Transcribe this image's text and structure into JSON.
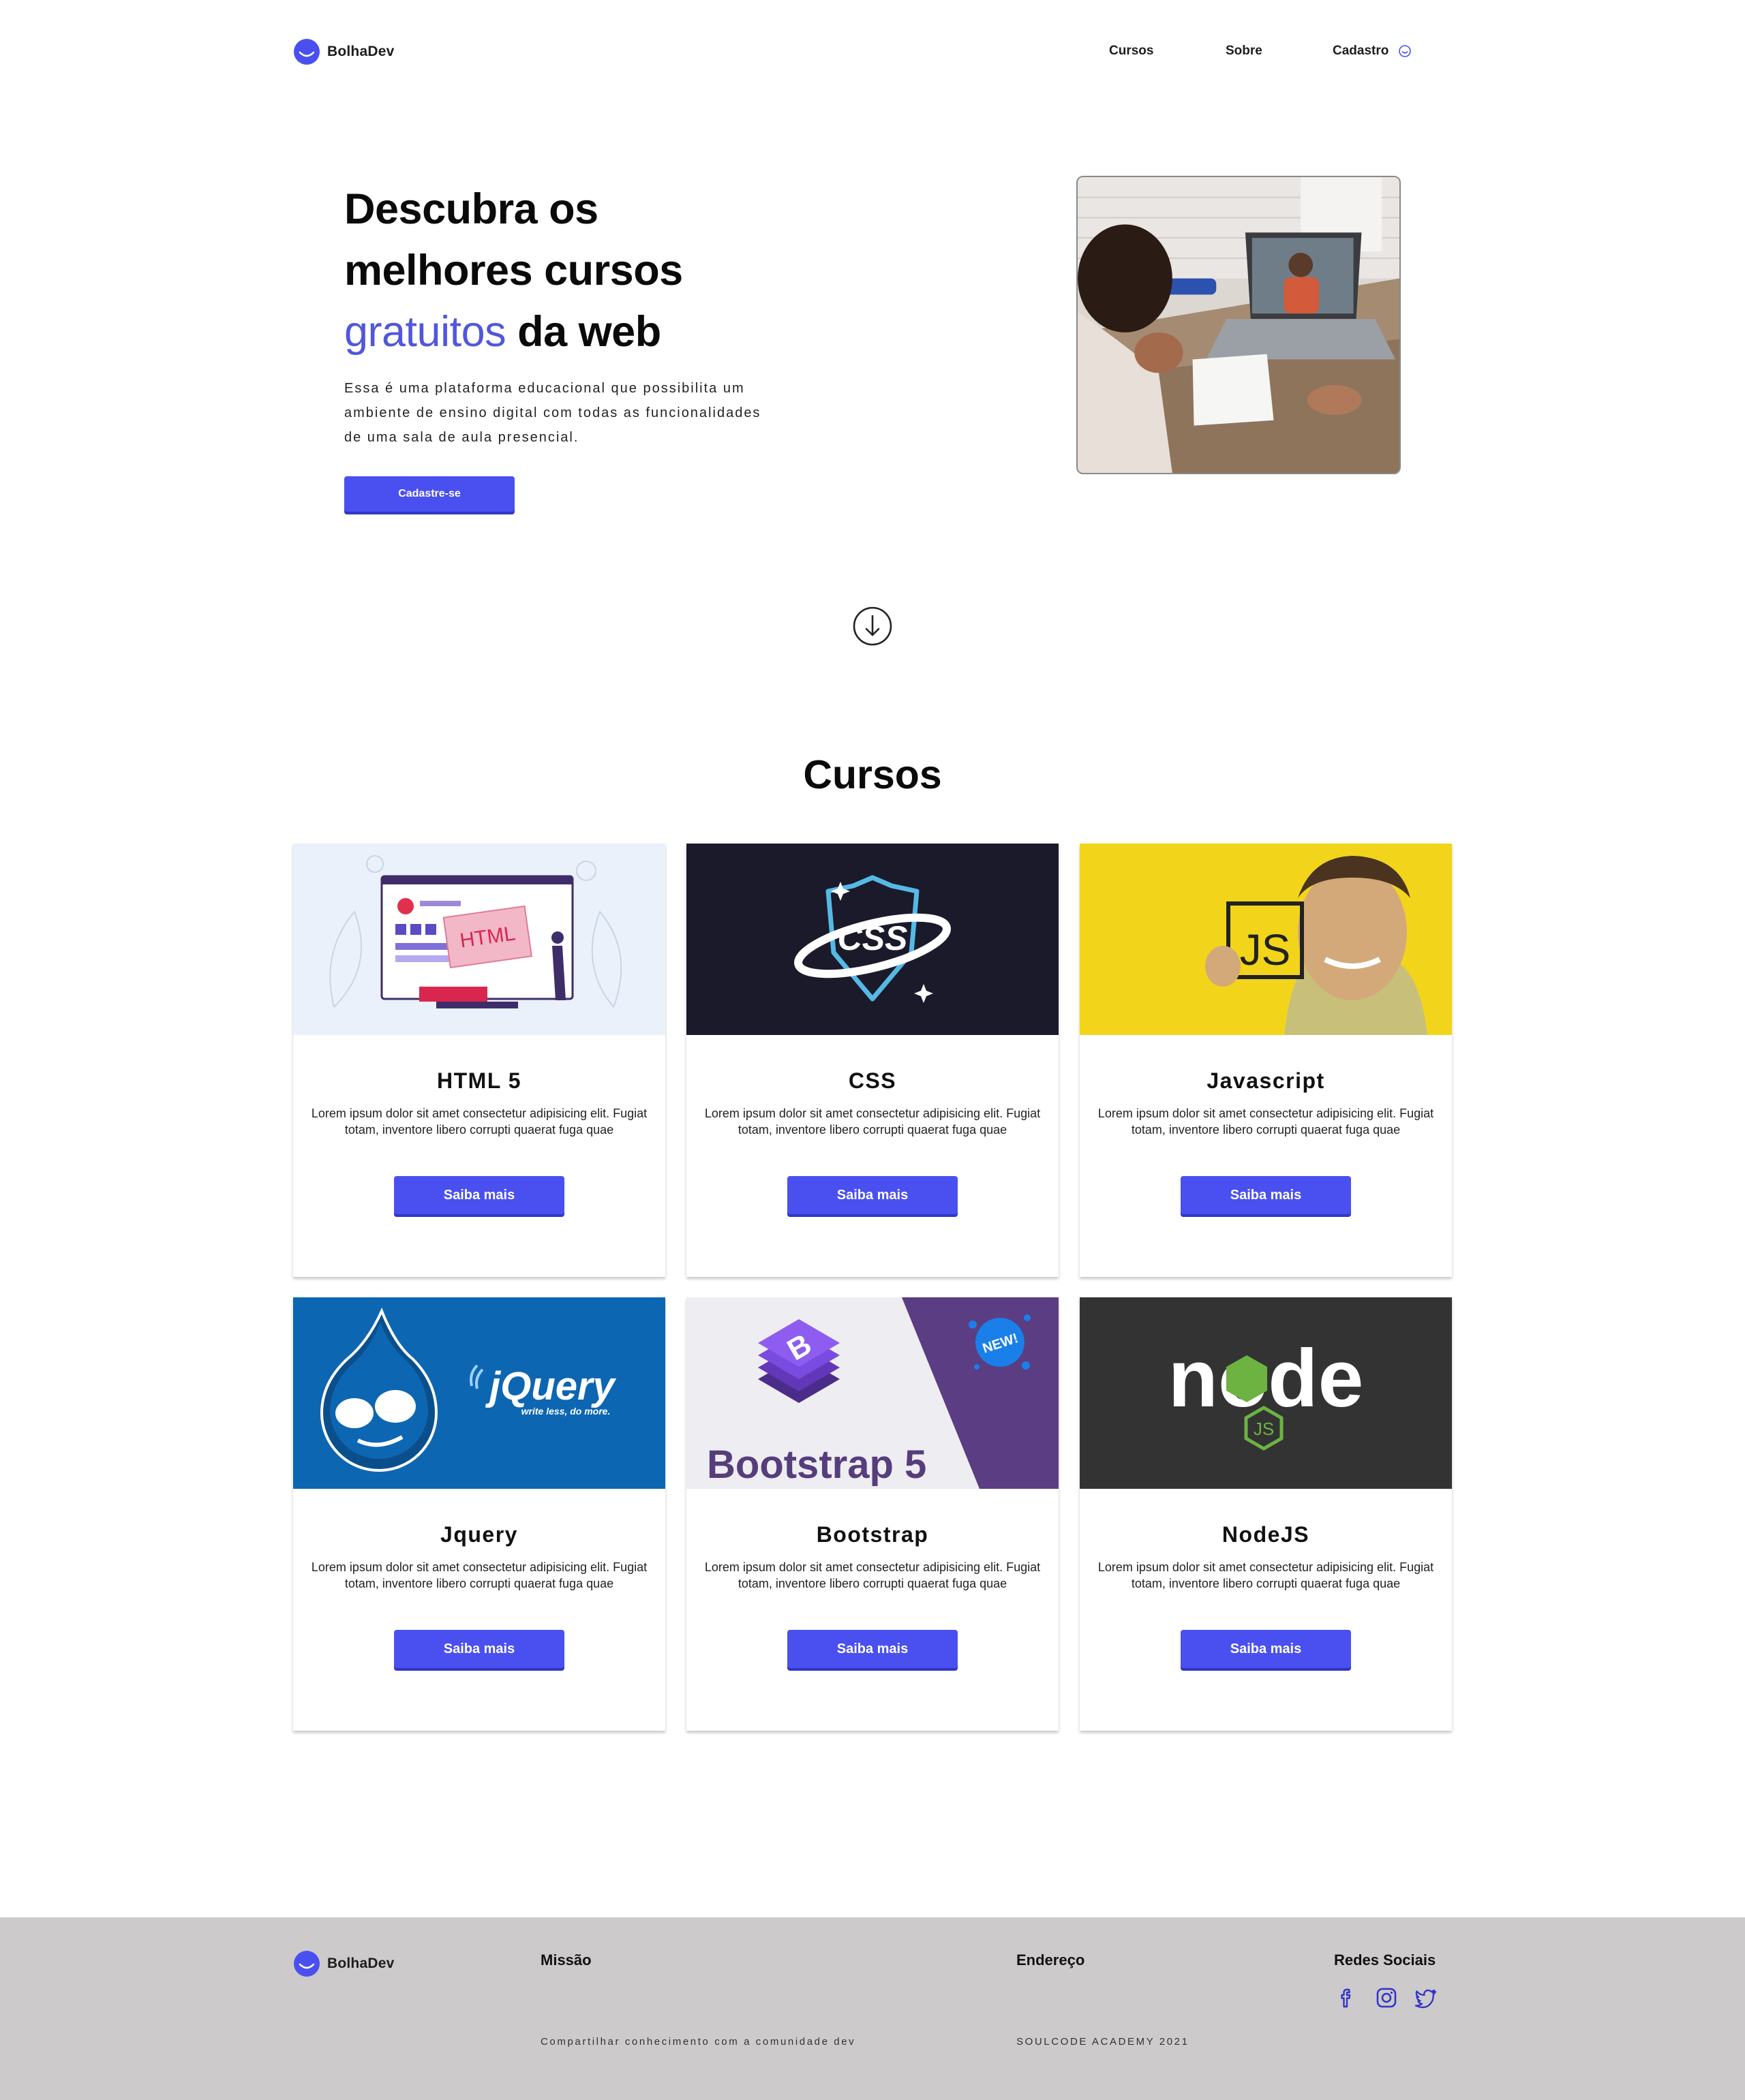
{
  "brand": {
    "name": "BolhaDev",
    "color": "#4a50f0"
  },
  "nav": {
    "items": [
      "Cursos",
      "Sobre",
      "Cadastro"
    ],
    "cadastro_icon": "smile-icon"
  },
  "hero": {
    "title_line1": "Descubra os",
    "title_line2": "melhores cursos",
    "title_accent": "gratuitos",
    "title_end": " da web",
    "text": "Essa é uma plataforma educacional que possibilita um ambiente de ensino digital com todas as funcionalidades de uma sala de aula presencial.",
    "cta": "Cadastre-se",
    "accent_color": "#5057dc",
    "scroll_icon": "arrow-down-circle-icon"
  },
  "courses": {
    "title": "Cursos",
    "items": [
      {
        "name": "HTML 5",
        "description": "Lorem ipsum dolor sit amet consectetur adipisicing elit. Fugiat totam, inventore libero corrupti quaerat fuga quae",
        "button": "Saiba mais",
        "image_label": "HTML"
      },
      {
        "name": "CSS",
        "description": "Lorem ipsum dolor sit amet consectetur adipisicing elit. Fugiat totam, inventore libero corrupti quaerat fuga quae",
        "button": "Saiba mais",
        "image_label": "CSS"
      },
      {
        "name": "Javascript",
        "description": "Lorem ipsum dolor sit amet consectetur adipisicing elit. Fugiat totam, inventore libero corrupti quaerat fuga quae",
        "button": "Saiba mais",
        "image_label": "JS"
      },
      {
        "name": "Jquery",
        "description": "Lorem ipsum dolor sit amet consectetur adipisicing elit. Fugiat totam, inventore libero corrupti quaerat fuga quae",
        "button": "Saiba mais",
        "image_label": "jQuery",
        "image_sublabel": "write less, do more."
      },
      {
        "name": "Bootstrap",
        "description": "Lorem ipsum dolor sit amet consectetur adipisicing elit. Fugiat totam, inventore libero corrupti quaerat fuga quae",
        "button": "Saiba mais",
        "image_label": "Bootstrap 5",
        "image_badge": "NEW!"
      },
      {
        "name": "NodeJS",
        "description": "Lorem ipsum dolor sit amet consectetur adipisicing elit. Fugiat totam, inventore libero corrupti quaerat fuga quae",
        "button": "Saiba mais",
        "image_label": "node",
        "image_sublabel": "JS"
      }
    ]
  },
  "footer": {
    "brand": "BolhaDev",
    "mission_title": "Missão",
    "mission_text": "Compartilhar conhecimento com a comunidade dev",
    "address_title": "Endereço",
    "address_text": "SOULCODE ACADEMY 2021",
    "social_title": "Redes Sociais",
    "social_icons": [
      "facebook-icon",
      "instagram-icon",
      "twitter-icon"
    ]
  }
}
